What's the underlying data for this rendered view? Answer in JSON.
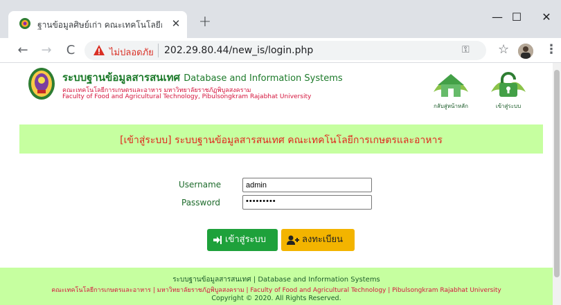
{
  "browser": {
    "tab_title": "ฐานข้อมูลศิษย์เก่า คณะเทคโนโลยีการเ",
    "tab_close": "✕",
    "new_tab": "+",
    "window_min": "—",
    "window_max": "☐",
    "window_close": "✕",
    "insecure_label": "ไม่ปลอดภัย",
    "url": "202.29.80.44/new_is/login.php",
    "back": "←",
    "forward": "→",
    "reload": "C",
    "key": "⚿",
    "star": "☆",
    "menu": "⋮"
  },
  "header": {
    "title_th": "ระบบฐานข้อมูลสารสนเทศ",
    "title_en": "Database and Information Systems",
    "faculty_th": "คณะเทคโนโลยีการเกษตรและอาหาร มหาวิทยาลัยราชภัฏพิบูลสงคราม",
    "faculty_en": "Faculty of Food and Agricultural Technology, Pibulsongkram Rajabhat University",
    "home_label": "กลับสู่หน้าหลัก",
    "login_label": "เข้าสู่ระบบ"
  },
  "banner": {
    "text": "[เข้าสู่ระบบ] ระบบฐานข้อมูลสารสนเทศ คณะเทคโนโลยีการเกษตรและอาหาร"
  },
  "form": {
    "username_label": "Username",
    "password_label": "Password",
    "username_value": "admin",
    "password_value": "•••••••••",
    "login_button": "เข้าสู่ระบบ",
    "register_button": "ลงทะเบียน"
  },
  "footer": {
    "line1": "ระบบฐานข้อมูลสารสนเทศ | Database and Information Systems",
    "line2": "คณะเทคโนโลยีการเกษตรและอาหาร | มหาวิทยาลัยราชภัฏพิบูลสงคราม | Faculty of Food and Agricultural Technology | Pibulsongkram Rajabhat University",
    "line3": "Copyright © 2020. All Rights Reserved."
  },
  "colors": {
    "accent_green": "#1ea13b",
    "banner_bg": "#c6ffa0",
    "banner_text": "#e0261d",
    "register_yellow": "#f3b400"
  },
  "icons": [
    "university-logo-icon",
    "home-icon",
    "unlock-icon",
    "sign-in-icon",
    "user-plus-icon",
    "warning-icon"
  ]
}
